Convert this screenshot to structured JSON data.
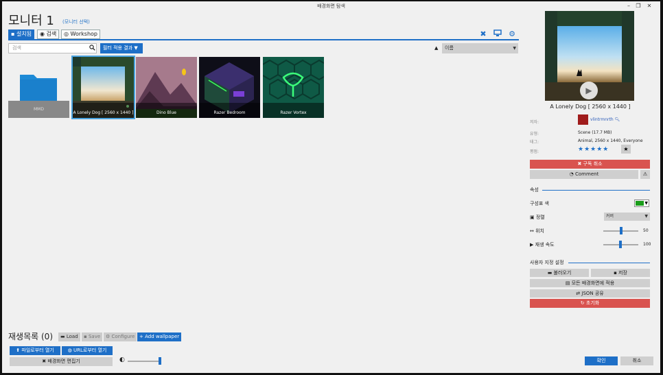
{
  "window": {
    "title": "배경화면 탐색",
    "minimize": "–",
    "maximize": "❐",
    "close": "✕"
  },
  "header": {
    "title": "모니터 1",
    "select_monitor": "(모니터 선택)"
  },
  "tabs": [
    {
      "label": "설치됨",
      "icon": "save-icon"
    },
    {
      "label": "검색",
      "icon": "compass-icon"
    },
    {
      "label": "Workshop",
      "icon": "steam-icon"
    }
  ],
  "toolbar": {
    "search_placeholder": "검색",
    "filter_label": "필터 적용 결과",
    "sort_value": "이름"
  },
  "grid": [
    {
      "label": "MMD",
      "type": "folder"
    },
    {
      "label": "A Lonely Dog [ 2560 x 1440 ]",
      "selected": true
    },
    {
      "label": "Dino Blue"
    },
    {
      "label": "Razer Bedroom"
    },
    {
      "label": "Razer Vortex"
    }
  ],
  "playlist": {
    "title": "재생목록",
    "count": "(0)",
    "load": "Load",
    "save": "Save",
    "configure": "Configure",
    "add": "Add wallpaper",
    "open_file": "파일로부터 열기",
    "open_url": "URL로부터 열기",
    "editor": "배경화면 편집기",
    "brightness": 1.0
  },
  "details": {
    "title": "A Lonely Dog [ 2560 x 1440 ]",
    "author_label": "저자:",
    "author": "vlintrmnrth",
    "type_label": "유형:",
    "type": "Scene (17.7 MB)",
    "tags_label": "태그:",
    "tags": "Animal, 2560 x 1440, Everyone",
    "rating_label": "평점:",
    "rating": 5,
    "unsubscribe": "구독 취소",
    "comment": "Comment"
  },
  "properties": {
    "section": "속성",
    "scheme_color_label": "구성표 색",
    "scheme_color": "#1a9c1a",
    "align_label": "정렬",
    "align_value": "커버",
    "position_label": "위치",
    "position_value": "50",
    "speed_label": "재생 속도",
    "speed_value": "100"
  },
  "presets": {
    "section": "사용자 지정 설정",
    "load": "불러오기",
    "save": "저장",
    "apply_all": "모든 배경화면에 적용",
    "json_share": "JSON 공유",
    "reset": "초기화"
  },
  "footer": {
    "ok": "확인",
    "cancel": "취소"
  }
}
